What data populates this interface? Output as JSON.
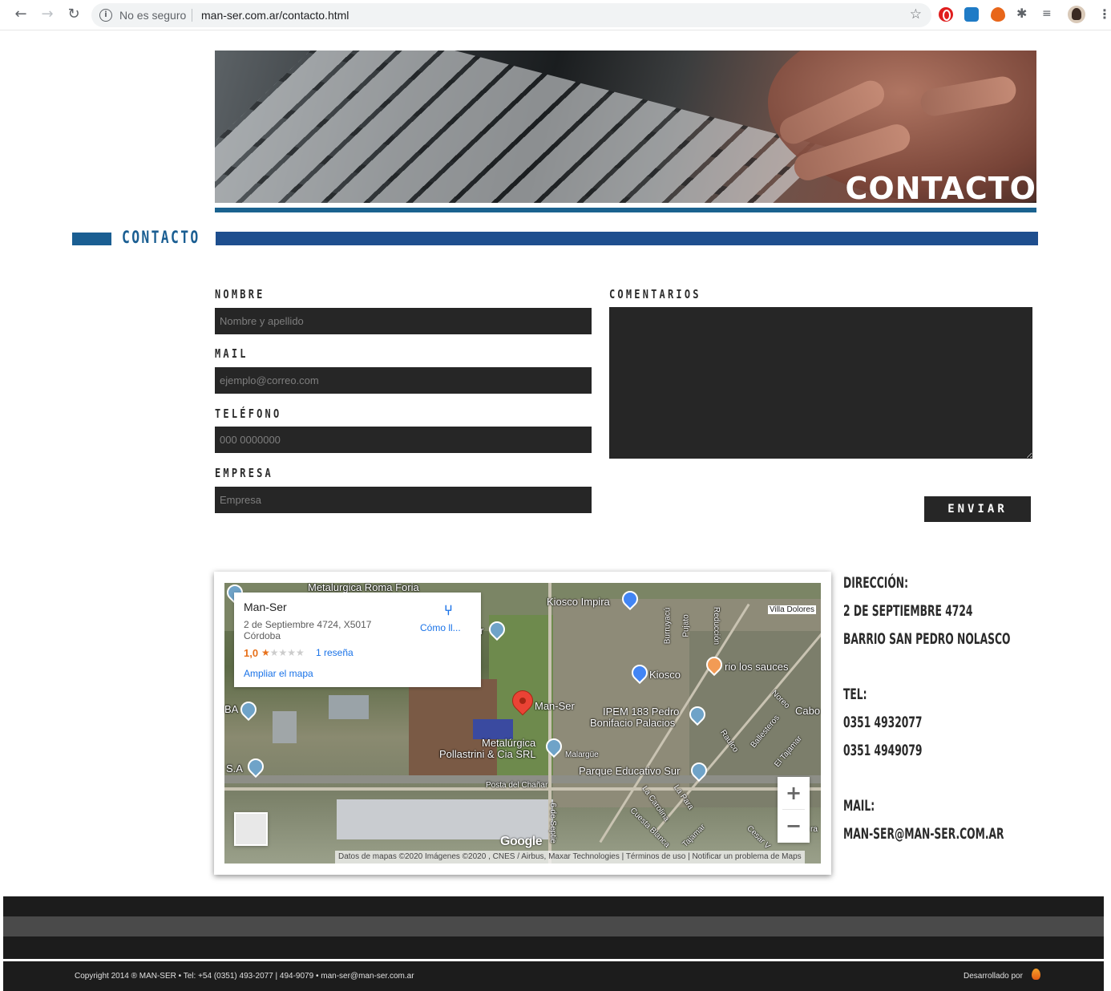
{
  "browser": {
    "security": "No es seguro",
    "url": "man-ser.com.ar/contacto.html"
  },
  "banner": {
    "title": "CONTACTO"
  },
  "section": {
    "title": "CONTACTO"
  },
  "form": {
    "name_label": "NOMBRE",
    "name_placeholder": "Nombre y apellido",
    "mail_label": "MAIL",
    "mail_placeholder": "ejemplo@correo.com",
    "phone_label": "TELÉFONO",
    "phone_placeholder": "000 0000000",
    "company_label": "EMPRESA",
    "company_placeholder": "Empresa",
    "comments_label": "COMENTARIOS",
    "send_label": "ENVIAR"
  },
  "map": {
    "place_name": "Man-Ser",
    "place_address": "2 de Septiembre 4724, X5017 Córdoba",
    "rating": "1,0",
    "reviews": "1 reseña",
    "larger_map": "Ampliar el mapa",
    "directions": "Cómo ll...",
    "labels": {
      "l1": "Metalurgica Roma Foria",
      "l2": "Kiosco Impira",
      "l3": "Villa Dolores",
      "l4": "Burruyacú",
      "l5": "Pujato",
      "l6": "Reducción",
      "l7": "rio los sauces",
      "l8": "Kiosco",
      "l9": "Man-Ser",
      "l10": "IPEM 183 Pedro",
      "l11": "Bonifacio Palacios",
      "l12": "Noreo",
      "l13": "Cabo",
      "l14": "Metalúrgica",
      "l15": "Pollastrini & Cia SRL",
      "l16": "Malargüe",
      "l17": "Parque Educativo Sur",
      "l18": "Posta del Chañar",
      "l19": "BA",
      "l20": "S.A",
      "l21": "Raulco",
      "l22": "Ballesteros",
      "l23": "El Tajamar",
      "l24": "La Carolina",
      "l25": "La Para",
      "l26": "Cuesta Blanca",
      "l27": "Tajamar",
      "l28": "Cesar V",
      "l29": "6 de Septie",
      "l30": "r",
      "l31": "ra"
    },
    "zoom_in": "+",
    "zoom_out": "−",
    "logo": "Google",
    "attribution": "Datos de mapas ©2020 Imágenes ©2020 , CNES / Airbus, Maxar Technologies | Términos de uso | Notificar un problema de Maps"
  },
  "contact_info": {
    "address_label": "DIRECCIÓN:",
    "address_line1": "2 DE SEPTIEMBRE 4724",
    "address_line2": "BARRIO SAN PEDRO NOLASCO",
    "tel_label": "TEL:",
    "tel1": "0351 4932077",
    "tel2": "0351 4949079",
    "mail_label": "MAIL:",
    "mail": "MAN-SER@MAN-SER.COM.AR"
  },
  "footer": {
    "copyright": "Copyright 2014 ® MAN-SER • Tel: +54 (0351) 493-2077 | 494-9079 • man-ser@man-ser.com.ar",
    "developed_by": "Desarrollado por"
  }
}
